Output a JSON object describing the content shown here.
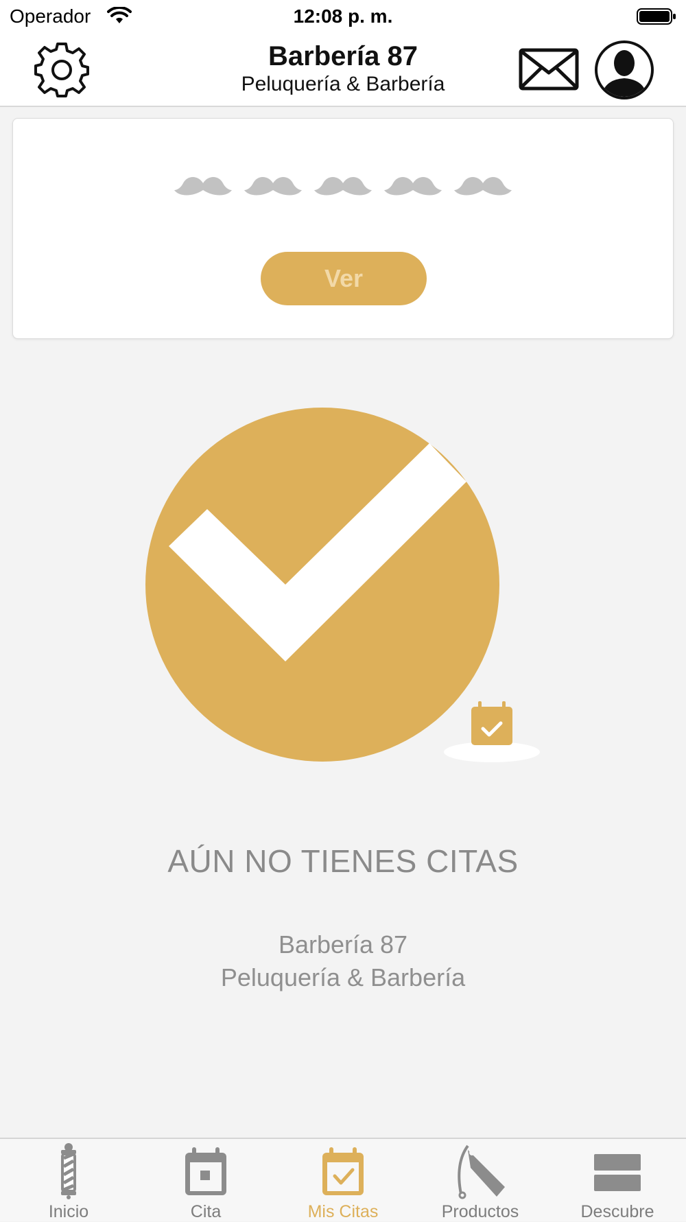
{
  "status_bar": {
    "carrier": "Operador",
    "time": "12:08 p. m."
  },
  "header": {
    "title": "Barbería 87",
    "subtitle": "Peluquería & Barbería",
    "icons": [
      "gear-icon",
      "mail-icon",
      "avatar-icon"
    ]
  },
  "rating_card": {
    "rating_filled": 0,
    "rating_max": 5,
    "button_label": "Ver"
  },
  "empty_state": {
    "title": "AÚN NO TIENES CITAS",
    "business_name": "Barbería 87",
    "business_subtitle": "Peluquería & Barbería"
  },
  "tab_bar": {
    "tabs": [
      {
        "label": "Inicio",
        "icon": "barber-pole-icon"
      },
      {
        "label": "Cita",
        "icon": "calendar-icon"
      },
      {
        "label": "Mis Citas",
        "icon": "calendar-check-icon"
      },
      {
        "label": "Productos",
        "icon": "razor-icon"
      },
      {
        "label": "Descubre",
        "icon": "list-icon"
      }
    ],
    "active_index": 2
  },
  "colors": {
    "accent": "#ddb05a",
    "inactive": "#7d7d7d",
    "text_muted": "#8a8a8a"
  }
}
